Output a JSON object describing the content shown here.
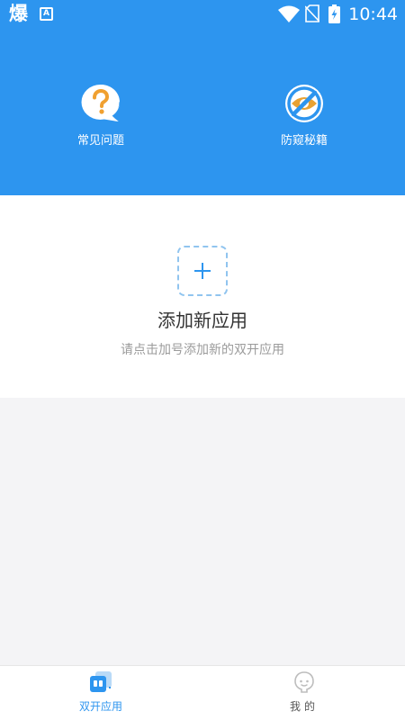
{
  "status_bar": {
    "app_glyph": "爆",
    "time": "10:44",
    "icons": [
      "app-notification-icon",
      "a-notification-icon",
      "wifi-icon",
      "no-sim-icon",
      "battery-charging-icon"
    ]
  },
  "header": {
    "background_color": "#2d95ef",
    "features": [
      {
        "label": "常见问题",
        "icon": "question-bubble-icon",
        "icon_color": "#f0a030"
      },
      {
        "label": "防窥秘籍",
        "icon": "no-peek-eye-icon",
        "icon_color": "#e9a233"
      }
    ]
  },
  "add_panel": {
    "title": "添加新应用",
    "subtitle": "请点击加号添加新的双开应用",
    "plus_icon": "plus-icon",
    "accent_color": "#90c4ef"
  },
  "bottom_nav": {
    "items": [
      {
        "label": "双开应用",
        "icon": "dual-app-icon",
        "active": true,
        "color": "#2d95ef"
      },
      {
        "label": "我的",
        "icon": "profile-face-icon",
        "active": false,
        "color": "#555555"
      }
    ]
  }
}
